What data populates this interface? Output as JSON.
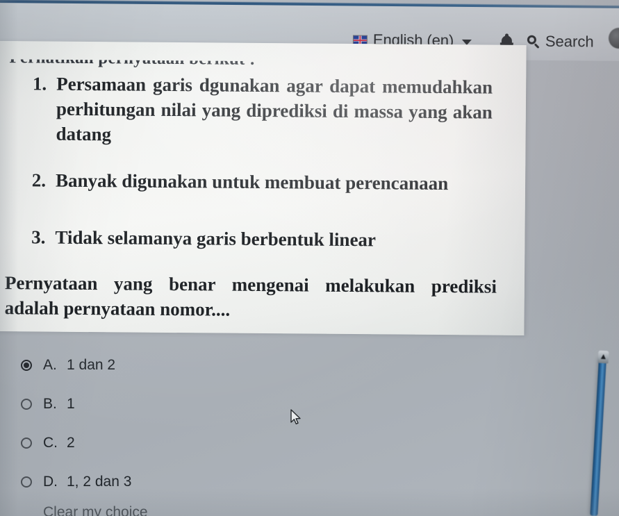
{
  "header": {
    "language": {
      "flag_icon": "uk-flag-icon",
      "label": "English (en)",
      "caret_icon": "chevron-down-icon"
    },
    "notifications_icon": "bell-icon",
    "search": {
      "icon": "search-icon",
      "label": "Search"
    },
    "avatar": "user-avatar"
  },
  "question": {
    "intro": "Perhatikan pernyataan berikut !",
    "statements": [
      {
        "number": "1.",
        "text": "Persamaan garis dgunakan agar dapat memudahkan perhitungan nilai yang diprediksi di massa yang akan datang"
      },
      {
        "number": "2.",
        "text": "Banyak digunakan untuk membuat perencanaan"
      },
      {
        "number": "3.",
        "text": "Tidak selamanya garis berbentuk linear"
      }
    ],
    "closing": "Pernyataan yang benar mengenai melakukan prediksi adalah pernyataan nomor...."
  },
  "answers": {
    "selected": "A",
    "options": [
      {
        "letter": "A.",
        "text": "1 dan 2",
        "selected": true
      },
      {
        "letter": "B.",
        "text": "1",
        "selected": false
      },
      {
        "letter": "C.",
        "text": "2",
        "selected": false
      },
      {
        "letter": "D.",
        "text": "1, 2 dan 3",
        "selected": false
      }
    ]
  },
  "clear_choice_label": "Clear my choice",
  "colors": {
    "page_background": "#aeb4bb",
    "header_background": "#bdc3c9",
    "top_rule": "#1f4b76",
    "question_card": "#f2f3f1",
    "text": "#21262b",
    "pen": "#2e6fa8"
  }
}
